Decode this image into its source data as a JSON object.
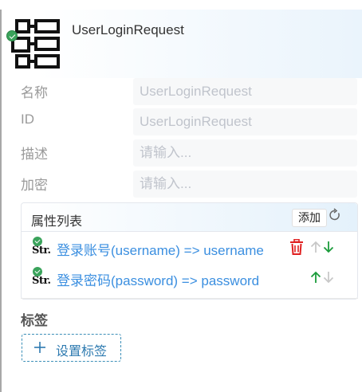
{
  "header": {
    "title": "UserLoginRequest",
    "icon": "model-struct-icon"
  },
  "form": {
    "fields": [
      {
        "label": "名称",
        "value": "UserLoginRequest",
        "placeholder": ""
      },
      {
        "label": "ID",
        "value": "UserLoginRequest",
        "placeholder": ""
      },
      {
        "label": "描述",
        "value": "",
        "placeholder": "请输入..."
      },
      {
        "label": "加密",
        "value": "",
        "placeholder": "请输入..."
      }
    ]
  },
  "attributes": {
    "title": "属性列表",
    "add_label": "添加",
    "type_badge": "Str.",
    "items": [
      {
        "text": "登录账号(username) => username"
      },
      {
        "text": "登录密码(password) => password"
      }
    ]
  },
  "tags": {
    "title": "标签",
    "button_label": "设置标签"
  },
  "colors": {
    "link": "#3b8fe0",
    "up_active": "#1a9b3a",
    "down_active": "#1a9b3a",
    "disabled": "#c8c8c8",
    "delete": "#e02020"
  }
}
